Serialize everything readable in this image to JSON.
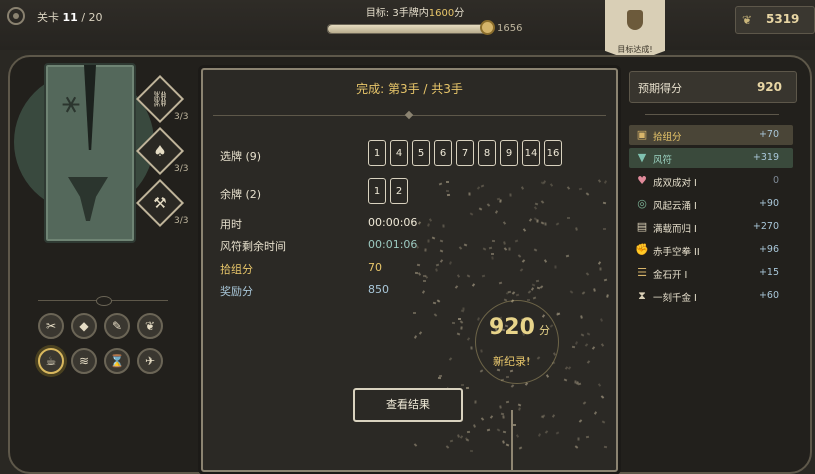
{
  "header": {
    "level_label": "关卡",
    "level_current": "11",
    "level_sep": "/",
    "level_total": "20",
    "goal_prefix": "目标: 3手牌内",
    "goal_value": "1600",
    "goal_suffix": "分",
    "progress_value": "1656",
    "progress_fraction": 1.0,
    "banner_text": "目标达成!",
    "coins": "5319"
  },
  "left": {
    "skills": [
      {
        "icon": "link-icon",
        "glyph": "⛓",
        "count": "3/3"
      },
      {
        "icon": "mushroom-icon",
        "glyph": "♠",
        "count": "3/3"
      },
      {
        "icon": "anvil-icon",
        "glyph": "⚒",
        "count": "3/3"
      }
    ],
    "tools": [
      {
        "name": "tool-tongs",
        "glyph": "✂"
      },
      {
        "name": "tool-stone",
        "glyph": "◆"
      },
      {
        "name": "tool-brush",
        "glyph": "✎"
      },
      {
        "name": "tool-feather",
        "glyph": "❦"
      },
      {
        "name": "tool-teapot",
        "glyph": "☕"
      },
      {
        "name": "tool-wave",
        "glyph": "≋"
      },
      {
        "name": "tool-hourglass",
        "glyph": "⌛"
      },
      {
        "name": "tool-bird",
        "glyph": "✈"
      }
    ]
  },
  "result": {
    "head_prefix": "完成: ",
    "head_hand": "第3手",
    "head_sep": " / ",
    "head_total": "共3手",
    "selected_label": "选牌 (9)",
    "selected_cards": [
      "1",
      "4",
      "5",
      "6",
      "7",
      "8",
      "9",
      "14",
      "16"
    ],
    "remaining_label": "余牌 (2)",
    "remaining_cards": [
      "1",
      "2"
    ],
    "time_label": "用时",
    "time_value": "00:00:06",
    "wind_label": "风符剩余时间",
    "wind_value": "00:01:06",
    "group_label": "拾组分",
    "group_value": "70",
    "bonus_label": "奖励分",
    "bonus_value": "850",
    "score": "920",
    "score_unit": "分",
    "record": "新纪录!",
    "button": "查看结果"
  },
  "expected": {
    "label": "预期得分",
    "value": "920",
    "items": [
      {
        "name": "拾组分",
        "value": "+70",
        "icon": "chest-icon",
        "glyph": "▣"
      },
      {
        "name": "风符",
        "value": "+319",
        "icon": "tornado-icon",
        "glyph": "▼"
      },
      {
        "name": "成双成对 I",
        "value": "0",
        "icon": "hearts-icon",
        "glyph": "♥"
      },
      {
        "name": "风起云涌 I",
        "value": "+90",
        "icon": "spiral-icon",
        "glyph": "◎"
      },
      {
        "name": "满载而归 I",
        "value": "+270",
        "icon": "basket-icon",
        "glyph": "▤"
      },
      {
        "name": "赤手空拳 II",
        "value": "+96",
        "icon": "fist-icon",
        "glyph": "✊"
      },
      {
        "name": "金石开 I",
        "value": "+15",
        "icon": "stones-icon",
        "glyph": "☰"
      },
      {
        "name": "一刻千金 I",
        "value": "+60",
        "icon": "hourglass-icon",
        "glyph": "⧗"
      }
    ]
  }
}
